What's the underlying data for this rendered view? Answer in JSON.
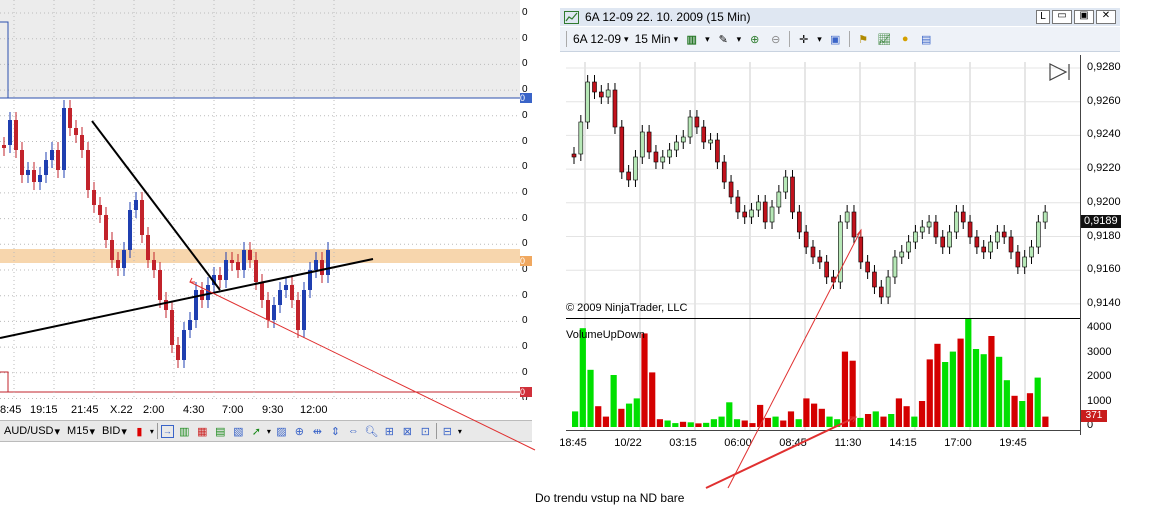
{
  "left_chart": {
    "y_ticks": [
      "0",
      "0",
      "0",
      "0",
      "0",
      "0",
      "0",
      "0",
      "0",
      "0",
      "0",
      "0",
      "0",
      "0",
      "0",
      "0"
    ],
    "price_flags": [
      "0",
      "0",
      "0"
    ],
    "x_ticks": [
      "8:45",
      "19:15",
      "21:45",
      "X.22",
      "2:00",
      "4:30",
      "7:00",
      "9:30",
      "12:00"
    ],
    "toolbar": {
      "symbol": "AUD/USD",
      "timeframe": "M15",
      "price_type": "BID"
    },
    "colors": {
      "bull": "#1f3fb0",
      "bear": "#c2232b",
      "zone": "#f7d6ad",
      "line": "#000000",
      "band": "#ececec"
    }
  },
  "right_chart": {
    "title": "6A 12-09  22. 10. 2009 (15 Min)",
    "title_buttons": [
      "L"
    ],
    "toolbar": {
      "instrument": "6A 12-09",
      "interval": "15 Min"
    },
    "copyright": "© 2009 NinjaTrader, LLC",
    "indicator_label": "VolumeUpDown",
    "price_ticks": [
      "0,9280",
      "0,9260",
      "0,9240",
      "0,9220",
      "0,9200",
      "0,9180",
      "0,9160",
      "0,9140"
    ],
    "last_price": "0,9189",
    "volume_ticks": [
      "4000",
      "3000",
      "2000",
      "1000",
      "0"
    ],
    "last_volume": "371",
    "x_ticks": [
      "18:45",
      "10/22",
      "03:15",
      "06:00",
      "08:45",
      "11:30",
      "14:15",
      "17:00",
      "19:45"
    ],
    "colors": {
      "up": "#00e000",
      "down": "#d40000",
      "up_candle": "#b7e8b7",
      "down_candle": "#c1121c"
    }
  },
  "annotation": {
    "text": "Do trendu  vstup na ND bare",
    "color": "#e03030"
  }
}
